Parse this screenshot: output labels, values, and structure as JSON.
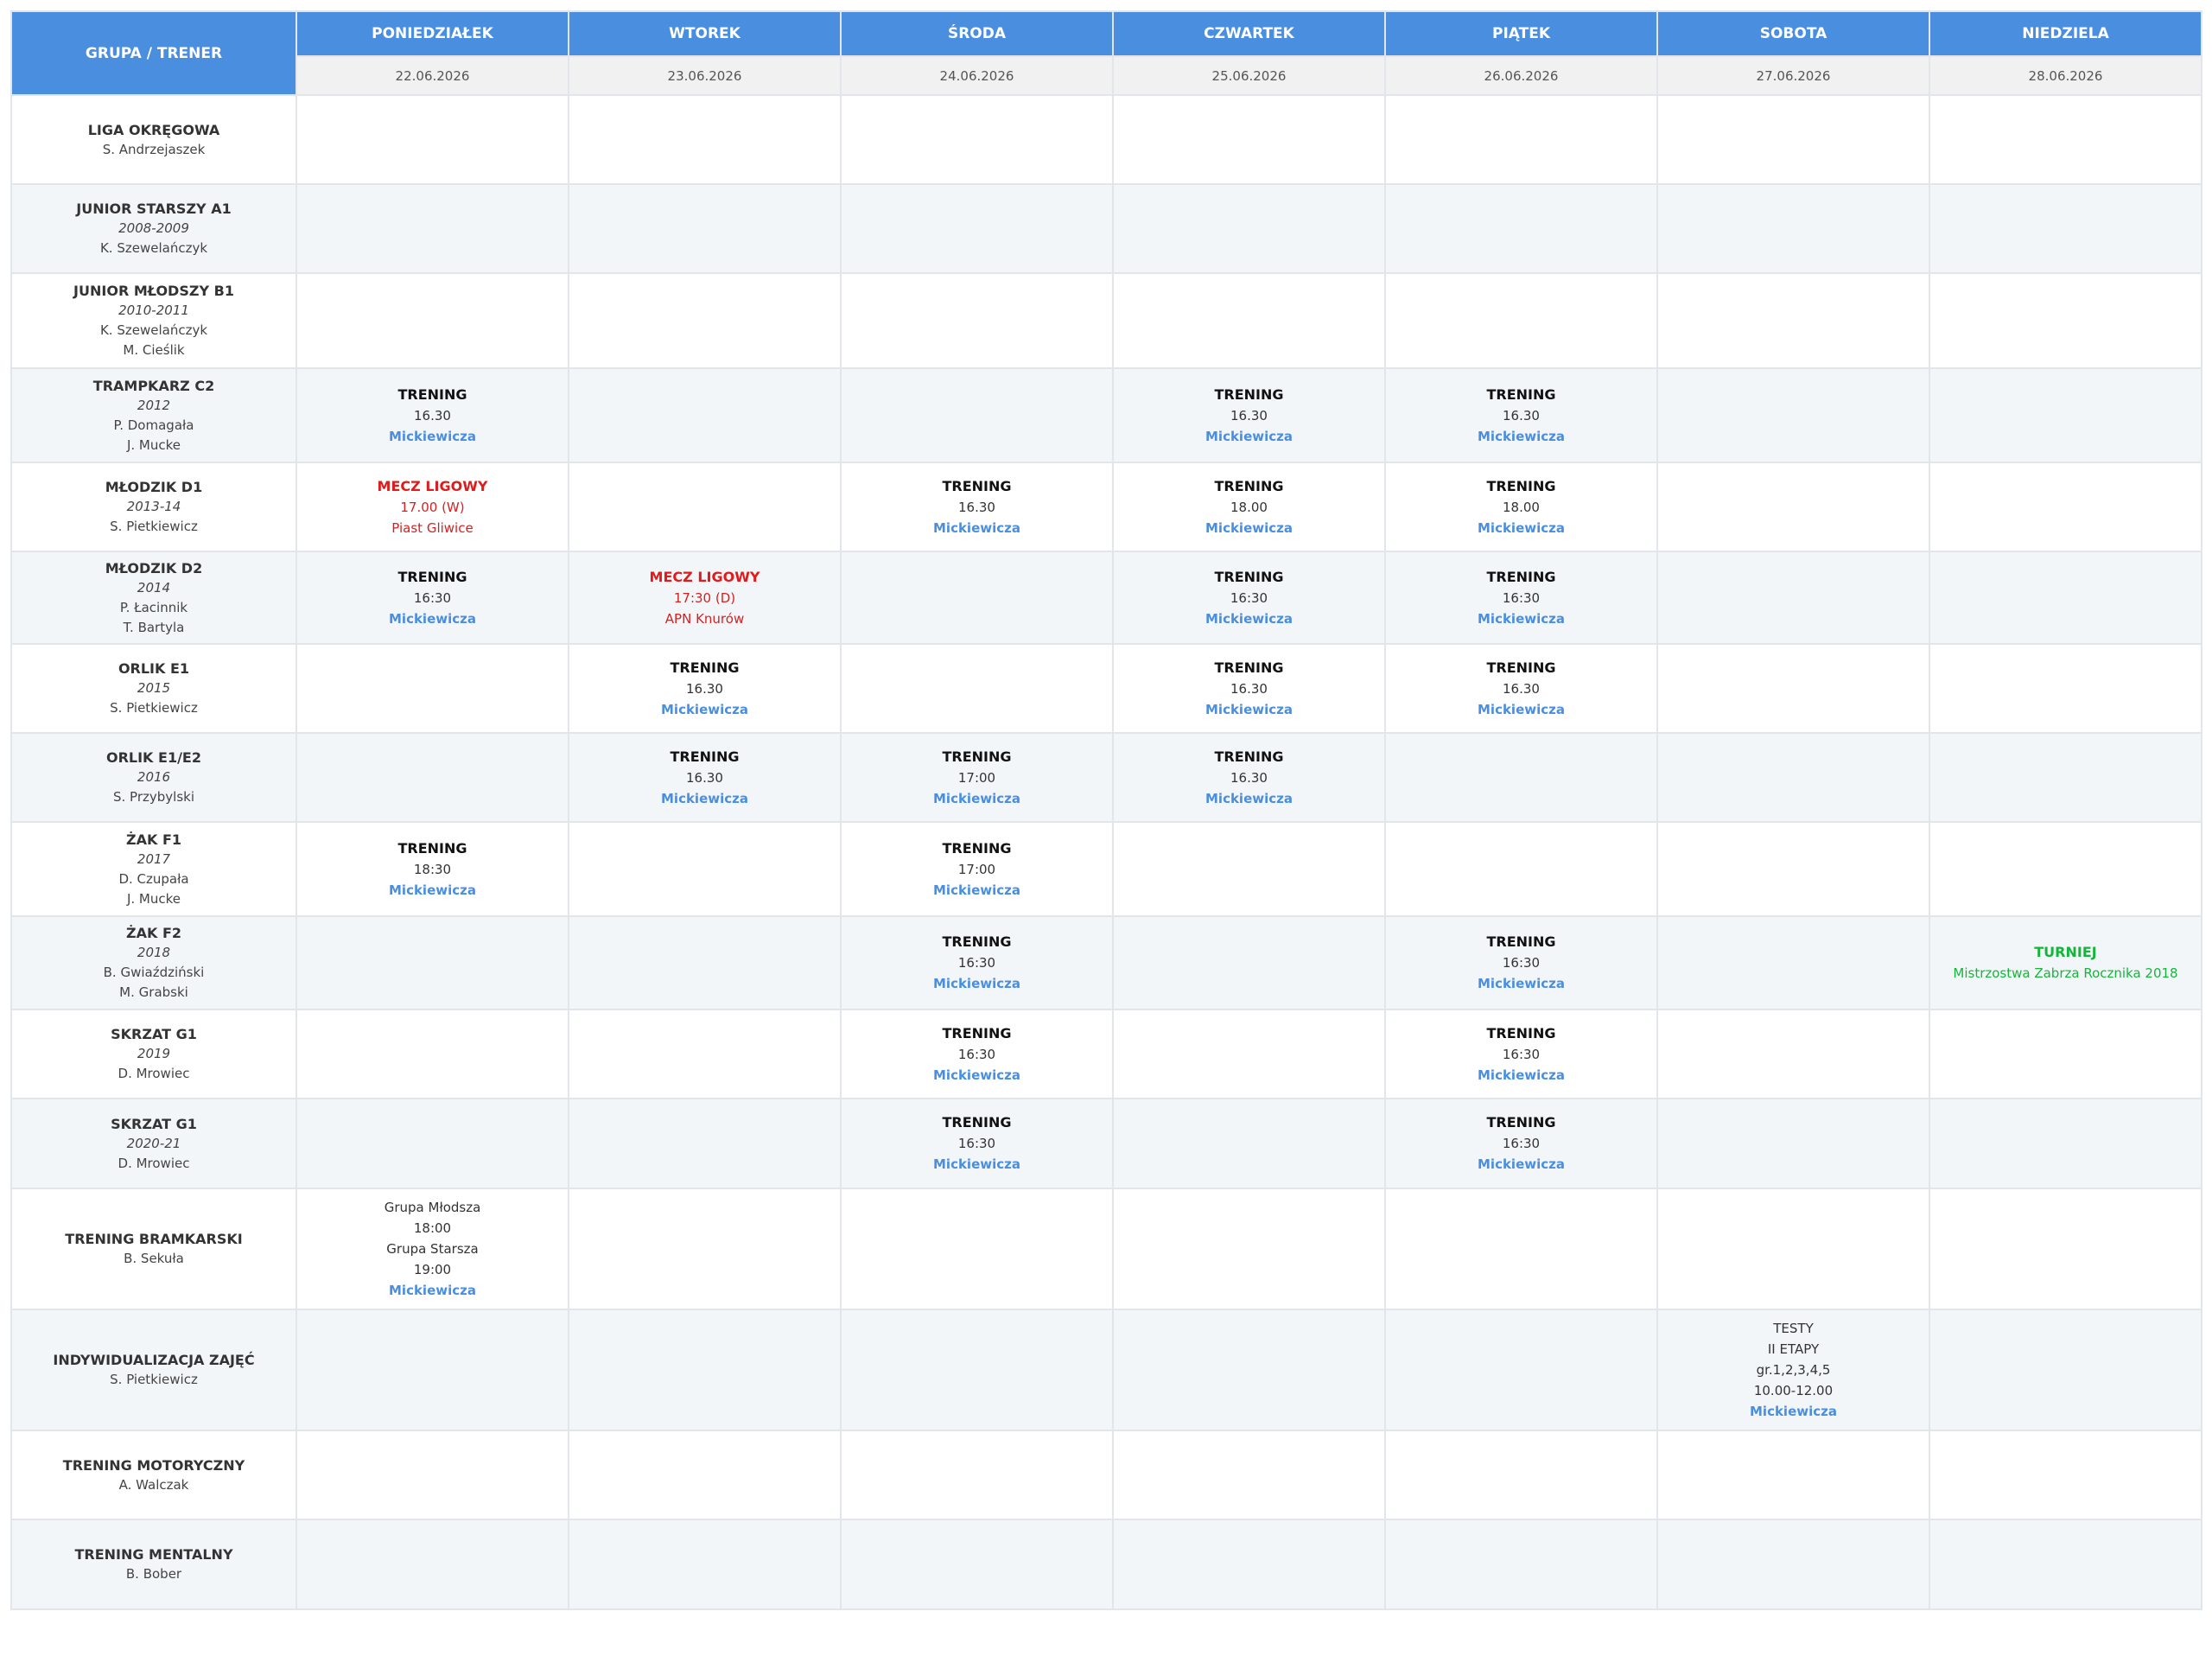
{
  "header": {
    "corner": "GRUPA / TRENER",
    "days": [
      {
        "name": "PONIEDZIAŁEK",
        "date": "22.06.2026"
      },
      {
        "name": "WTOREK",
        "date": "23.06.2026"
      },
      {
        "name": "ŚRODA",
        "date": "24.06.2026"
      },
      {
        "name": "CZWARTEK",
        "date": "25.06.2026"
      },
      {
        "name": "PIĄTEK",
        "date": "26.06.2026"
      },
      {
        "name": "SOBOTA",
        "date": "27.06.2026"
      },
      {
        "name": "NIEDZIELA",
        "date": "28.06.2026"
      }
    ]
  },
  "rows": [
    {
      "name": "LIGA OKRĘGOWA",
      "year": "",
      "coaches": [
        "S. Andrzejaszek"
      ],
      "cells": [
        null,
        null,
        null,
        null,
        null,
        null,
        null
      ]
    },
    {
      "name": "JUNIOR STARSZY A1",
      "year": "2008-2009",
      "coaches": [
        "K. Szewelańczyk"
      ],
      "cells": [
        null,
        null,
        null,
        null,
        null,
        null,
        null
      ]
    },
    {
      "name": "JUNIOR MŁODSZY B1",
      "year": "2010-2011",
      "coaches": [
        "K. Szewelańczyk",
        "M. Cieślik"
      ],
      "cells": [
        null,
        null,
        null,
        null,
        null,
        null,
        null
      ]
    },
    {
      "name": "TRAMPKARZ C2",
      "year": "2012",
      "coaches": [
        "P. Domagała",
        "J. Mucke"
      ],
      "cells": [
        {
          "kind": "trening",
          "title": "TRENING",
          "time": "16.30",
          "place": "Mickiewicza"
        },
        null,
        null,
        {
          "kind": "trening",
          "title": "TRENING",
          "time": "16.30",
          "place": "Mickiewicza"
        },
        {
          "kind": "trening",
          "title": "TRENING",
          "time": "16.30",
          "place": "Mickiewicza"
        },
        null,
        null
      ]
    },
    {
      "name": "MŁODZIK D1",
      "year": "2013-14",
      "coaches": [
        "S. Pietkiewicz"
      ],
      "cells": [
        {
          "kind": "mecz",
          "title": "MECZ LIGOWY",
          "time": "17.00 (W)",
          "opponent": "Piast Gliwice"
        },
        null,
        {
          "kind": "trening",
          "title": "TRENING",
          "time": "16.30",
          "place": "Mickiewicza"
        },
        {
          "kind": "trening",
          "title": "TRENING",
          "time": "18.00",
          "place": "Mickiewicza"
        },
        {
          "kind": "trening",
          "title": "TRENING",
          "time": "18.00",
          "place": "Mickiewicza"
        },
        null,
        null
      ]
    },
    {
      "name": "MŁODZIK D2",
      "year": "2014",
      "coaches": [
        "P. Łacinnik",
        "T. Bartyla"
      ],
      "cells": [
        {
          "kind": "trening",
          "title": "TRENING",
          "time": "16:30",
          "place": "Mickiewicza"
        },
        {
          "kind": "mecz",
          "title": "MECZ LIGOWY",
          "time": "17:30 (D)",
          "opponent": "APN Knurów"
        },
        null,
        {
          "kind": "trening",
          "title": "TRENING",
          "time": "16:30",
          "place": "Mickiewicza"
        },
        {
          "kind": "trening",
          "title": "TRENING",
          "time": "16:30",
          "place": "Mickiewicza"
        },
        null,
        null
      ]
    },
    {
      "name": "ORLIK E1",
      "year": "2015",
      "coaches": [
        "S. Pietkiewicz"
      ],
      "cells": [
        null,
        {
          "kind": "trening",
          "title": "TRENING",
          "time": "16.30",
          "place": "Mickiewicza"
        },
        null,
        {
          "kind": "trening",
          "title": "TRENING",
          "time": "16.30",
          "place": "Mickiewicza"
        },
        {
          "kind": "trening",
          "title": "TRENING",
          "time": "16.30",
          "place": "Mickiewicza"
        },
        null,
        null
      ]
    },
    {
      "name": "ORLIK E1/E2",
      "year": "2016",
      "coaches": [
        "S. Przybylski"
      ],
      "cells": [
        null,
        {
          "kind": "trening",
          "title": "TRENING",
          "time": "16.30",
          "place": "Mickiewicza"
        },
        {
          "kind": "trening",
          "title": "TRENING",
          "time": "17:00",
          "place": "Mickiewicza"
        },
        {
          "kind": "trening",
          "title": "TRENING",
          "time": "16.30",
          "place": "Mickiewicza"
        },
        null,
        null,
        null
      ]
    },
    {
      "name": "ŻAK F1",
      "year": "2017",
      "coaches": [
        "D. Czupała",
        "J. Mucke"
      ],
      "cells": [
        {
          "kind": "trening",
          "title": "TRENING",
          "time": "18:30",
          "place": "Mickiewicza"
        },
        null,
        {
          "kind": "trening",
          "title": "TRENING",
          "time": "17:00",
          "place": "Mickiewicza"
        },
        null,
        null,
        null,
        null
      ]
    },
    {
      "name": "ŻAK F2",
      "year": "2018",
      "coaches": [
        "B. Gwiaździński",
        "M. Grabski"
      ],
      "cells": [
        null,
        null,
        {
          "kind": "trening",
          "title": "TRENING",
          "time": "16:30",
          "place": "Mickiewicza"
        },
        null,
        {
          "kind": "trening",
          "title": "TRENING",
          "time": "16:30",
          "place": "Mickiewicza"
        },
        null,
        {
          "kind": "turniej",
          "title": "TURNIEJ",
          "name": "Mistrzostwa Zabrza Rocznika 2018"
        }
      ]
    },
    {
      "name": "SKRZAT G1",
      "year": "2019",
      "coaches": [
        "D. Mrowiec"
      ],
      "cells": [
        null,
        null,
        {
          "kind": "trening",
          "title": "TRENING",
          "time": "16:30",
          "place": "Mickiewicza"
        },
        null,
        {
          "kind": "trening",
          "title": "TRENING",
          "time": "16:30",
          "place": "Mickiewicza"
        },
        null,
        null
      ]
    },
    {
      "name": "SKRZAT G1",
      "year": "2020-21",
      "coaches": [
        "D. Mrowiec"
      ],
      "cells": [
        null,
        null,
        {
          "kind": "trening",
          "title": "TRENING",
          "time": "16:30",
          "place": "Mickiewicza"
        },
        null,
        {
          "kind": "trening",
          "title": "TRENING",
          "time": "16:30",
          "place": "Mickiewicza"
        },
        null,
        null
      ]
    },
    {
      "name": "TRENING BRAMKARSKI",
      "year": "",
      "coaches": [
        "B. Sekuła"
      ],
      "cells": [
        {
          "kind": "lines",
          "lines": [
            "Grupa Młodsza",
            "18:00",
            "Grupa Starsza",
            "19:00"
          ],
          "place": "Mickiewicza"
        },
        null,
        null,
        null,
        null,
        null,
        null
      ]
    },
    {
      "name": "INDYWIDUALIZACJA ZAJĘĆ",
      "year": "",
      "coaches": [
        "S. Pietkiewicz"
      ],
      "cells": [
        null,
        null,
        null,
        null,
        null,
        {
          "kind": "lines",
          "lines": [
            "TESTY",
            "II ETAPY",
            "gr.1,2,3,4,5",
            "10.00-12.00"
          ],
          "place": "Mickiewicza"
        },
        null
      ]
    },
    {
      "name": "TRENING MOTORYCZNY",
      "year": "",
      "coaches": [
        "A. Walczak"
      ],
      "cells": [
        null,
        null,
        null,
        null,
        null,
        null,
        null
      ]
    },
    {
      "name": "TRENING MENTALNY",
      "year": "",
      "coaches": [
        "B. Bober"
      ],
      "cells": [
        null,
        null,
        null,
        null,
        null,
        null,
        null
      ]
    }
  ]
}
